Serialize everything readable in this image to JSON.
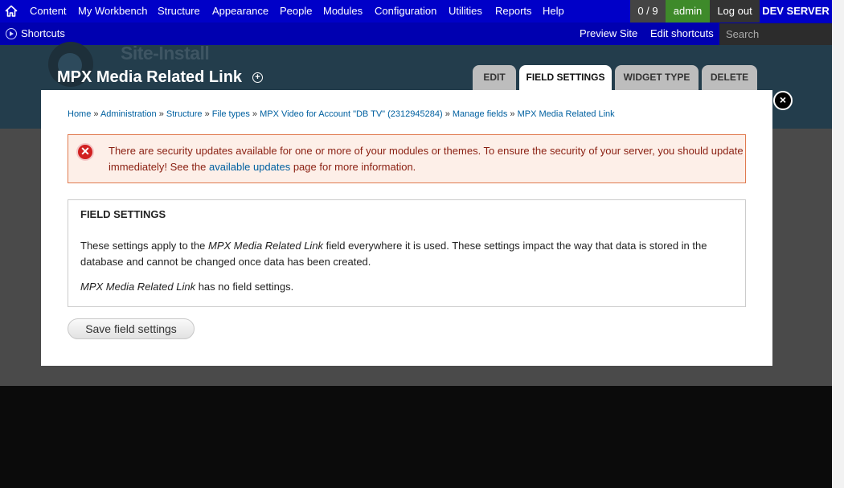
{
  "toolbar": {
    "menu": [
      {
        "label": "Content"
      },
      {
        "label": "My Workbench"
      },
      {
        "label": "Structure"
      },
      {
        "label": "Appearance"
      },
      {
        "label": "People"
      },
      {
        "label": "Modules"
      },
      {
        "label": "Configuration"
      },
      {
        "label": "Utilities"
      },
      {
        "label": "Reports"
      },
      {
        "label": "Help"
      }
    ],
    "count": "0 / 9",
    "user": "admin",
    "logout": "Log out",
    "server": "DEV SERVER"
  },
  "shortcuts": {
    "label": "Shortcuts",
    "preview": "Preview Site",
    "edit": "Edit shortcuts",
    "search_placeholder": "Search"
  },
  "header": {
    "site_name": "Site-Install",
    "title": "MPX Media Related Link",
    "tabs": [
      {
        "label": "EDIT"
      },
      {
        "label": "FIELD SETTINGS",
        "active": true
      },
      {
        "label": "WIDGET TYPE"
      },
      {
        "label": "DELETE"
      }
    ]
  },
  "breadcrumb": [
    "Home",
    "Administration",
    "Structure",
    "File types",
    "MPX Video for Account \"DB TV\" (2312945284)",
    "Manage fields",
    "MPX Media Related Link"
  ],
  "message": {
    "text_before": "There are security updates available for one or more of your modules or themes. To ensure the security of your server, you should update immediately! See the ",
    "link": "available updates",
    "text_after": " page for more information."
  },
  "fieldset": {
    "legend": "FIELD SETTINGS",
    "desc_prefix": "These settings apply to the ",
    "desc_field": "MPX Media Related Link",
    "desc_suffix": " field everywhere it is used. These settings impact the way that data is stored in the database and cannot be changed once data has been created.",
    "note_field": "MPX Media Related Link",
    "note_suffix": " has no field settings."
  },
  "save_button": "Save field settings",
  "close": "×"
}
